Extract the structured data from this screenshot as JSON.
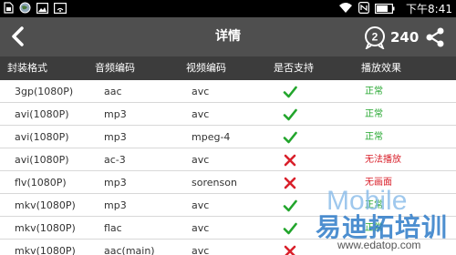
{
  "status_bar": {
    "time": "下午8:41",
    "left_icons": [
      "sim-card-icon",
      "globe-icon",
      "image-icon",
      "wifi-share-icon"
    ],
    "right_icons": [
      "wifi-icon",
      "nfc-icon",
      "battery-icon"
    ]
  },
  "app_bar": {
    "title": "详情",
    "badge_number": "2",
    "count": "240"
  },
  "table": {
    "headers": {
      "container": "封装格式",
      "audio": "音频编码",
      "video": "视频编码",
      "supported": "是否支持",
      "effect": "播放效果"
    },
    "rows": [
      {
        "container": "3gp(1080P)",
        "audio": "aac",
        "video": "avc",
        "supported": true,
        "effect": "正常"
      },
      {
        "container": "avi(1080P)",
        "audio": "mp3",
        "video": "avc",
        "supported": true,
        "effect": "正常"
      },
      {
        "container": "avi(1080P)",
        "audio": "mp3",
        "video": "mpeg-4",
        "supported": true,
        "effect": "正常"
      },
      {
        "container": "avi(1080P)",
        "audio": "ac-3",
        "video": "avc",
        "supported": false,
        "effect": "无法播放"
      },
      {
        "container": "flv(1080P)",
        "audio": "mp3",
        "video": "sorenson",
        "supported": false,
        "effect": "无画面"
      },
      {
        "container": "mkv(1080P)",
        "audio": "mp3",
        "video": "avc",
        "supported": true,
        "effect": "正常"
      },
      {
        "container": "mkv(1080P)",
        "audio": "flac",
        "video": "avc",
        "supported": true,
        "effect": "正常"
      },
      {
        "container": "mkv(1080P)",
        "audio": "aac(main)",
        "video": "avc",
        "supported": false,
        "effect": ""
      }
    ]
  },
  "colors": {
    "ok": "#22a52c",
    "fail": "#d9202b",
    "app_bar": "#4f4f4f",
    "header": "#3c3c3c"
  },
  "watermark": {
    "brand": "Mobile",
    "text": "易迪拓培训",
    "url": "www.edatop.com"
  }
}
